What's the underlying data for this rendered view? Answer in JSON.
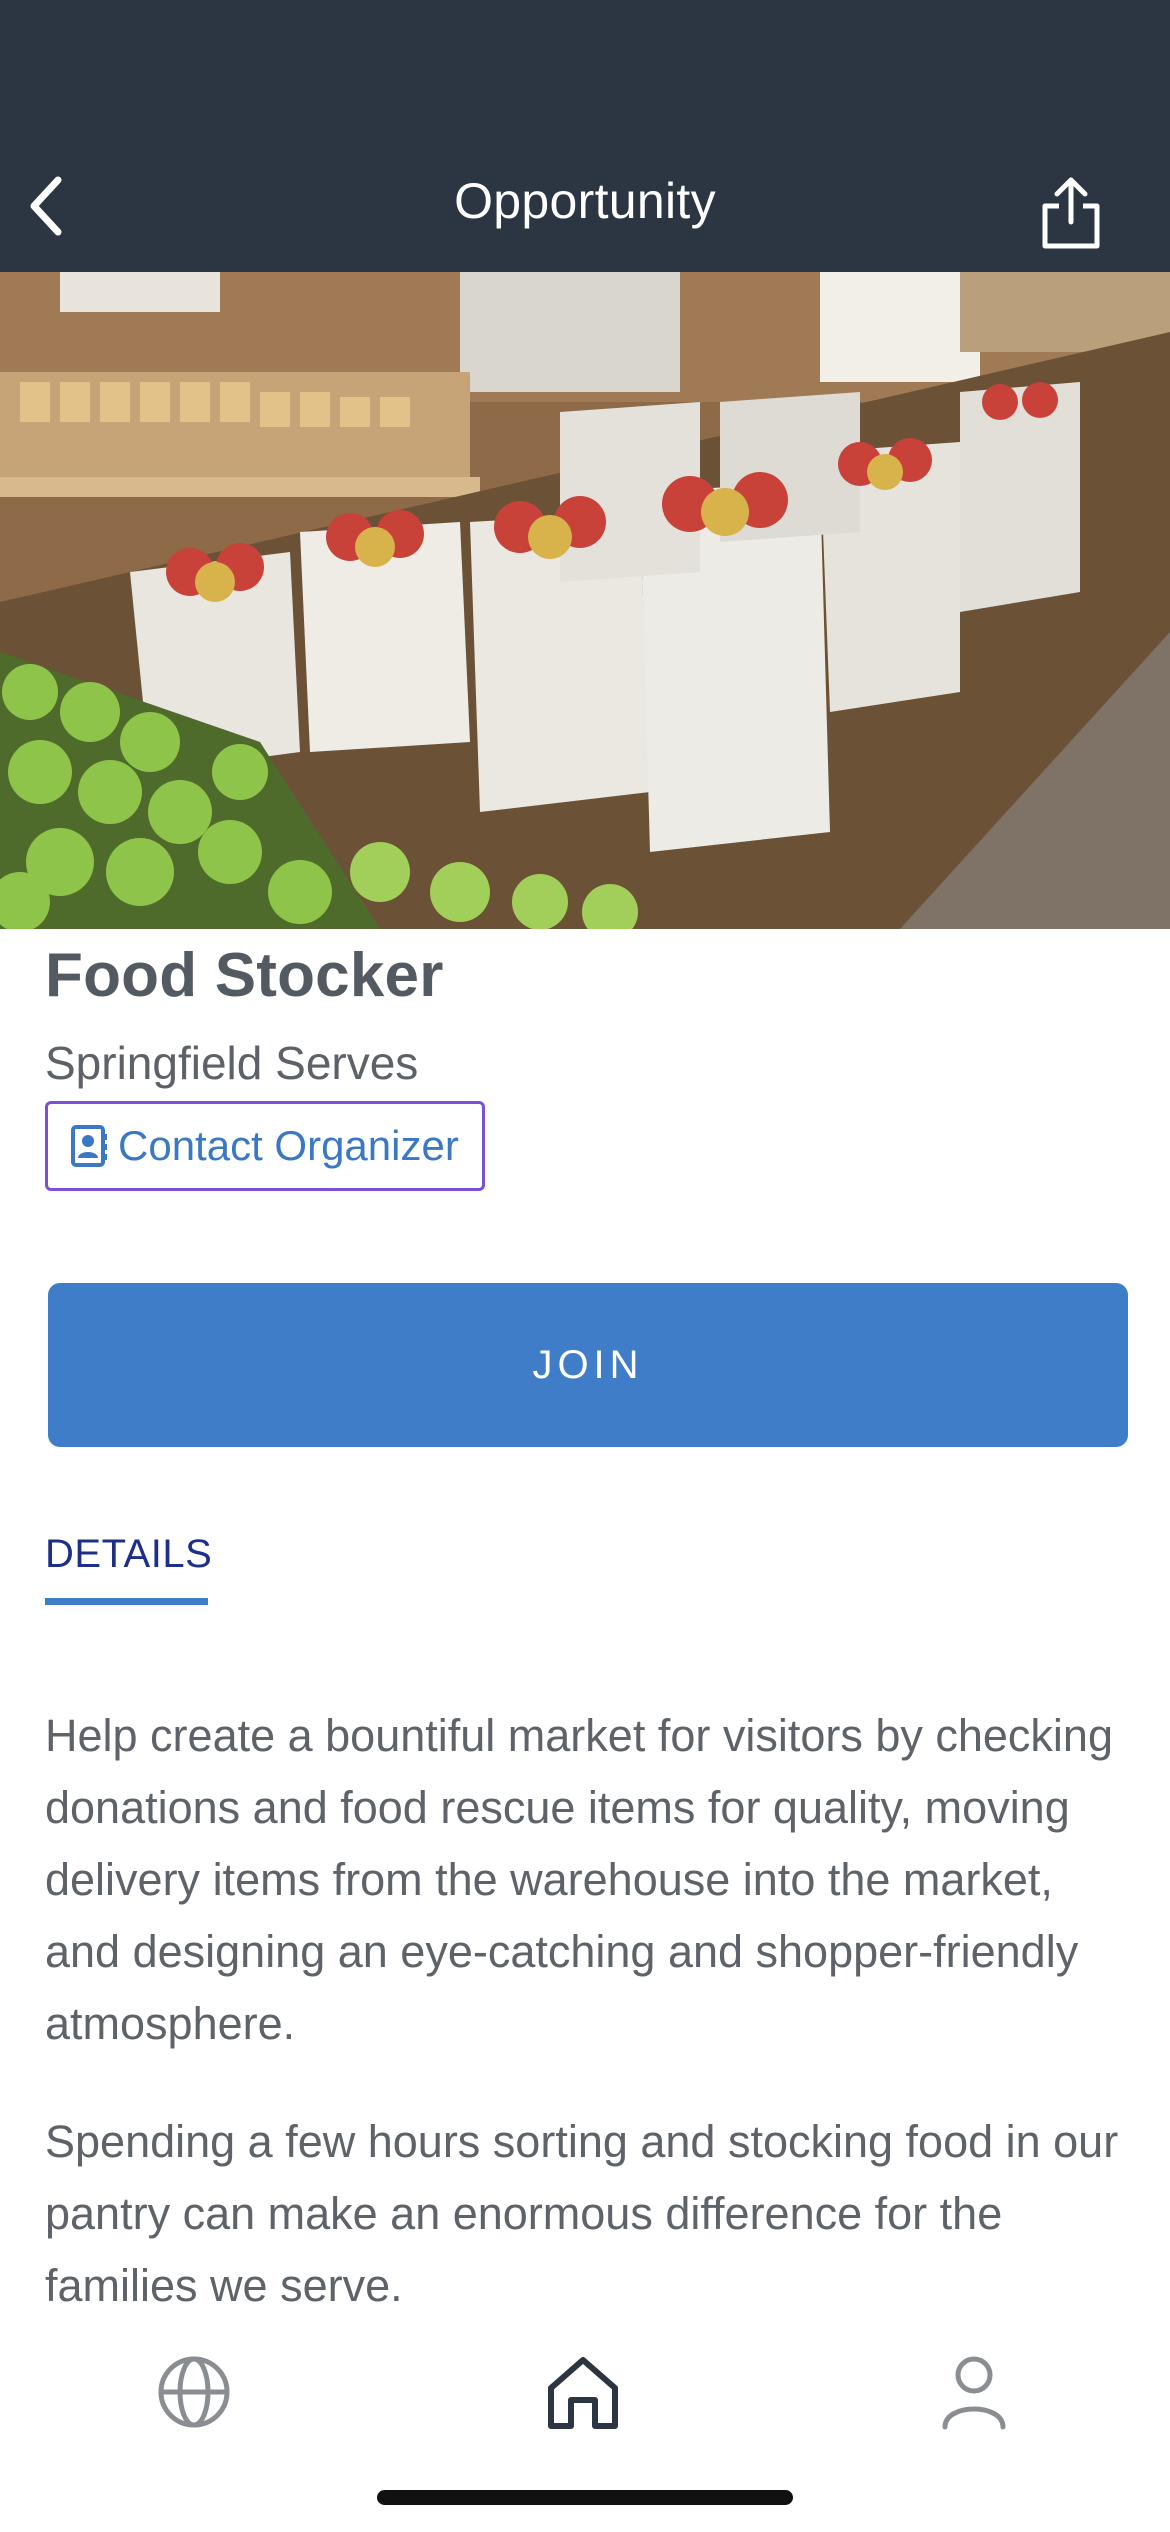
{
  "header": {
    "title": "Opportunity",
    "background": "#2b3642",
    "back_icon": "chevron-left-icon",
    "share_icon": "share-icon"
  },
  "hero": {
    "image_subject": "bags of apples in a farm market"
  },
  "opportunity": {
    "title": "Food Stocker",
    "organization": "Springfield Serves",
    "contact_label": "Contact Organizer",
    "contact_icon": "contact-card-icon",
    "join_label": "JOIN"
  },
  "tabs": {
    "details_label": "DETAILS"
  },
  "description": {
    "paragraph_1": "Help create a bountiful market for visitors by checking donations and food rescue items for quality, moving delivery items from the warehouse into the market, and designing an eye-catching and shopper-friendly atmosphere.",
    "paragraph_2": "Spending a few hours sorting and stocking food in our pantry can make an enormous difference for the families we serve."
  },
  "bottom_nav": {
    "items": [
      "globe-icon",
      "home-icon",
      "profile-icon"
    ],
    "active": "home-icon"
  },
  "colors": {
    "accent": "#3f7dc8",
    "tab_text": "#1e2f8a",
    "contact_border": "#7b4fd6",
    "body_text": "#5e636a"
  }
}
